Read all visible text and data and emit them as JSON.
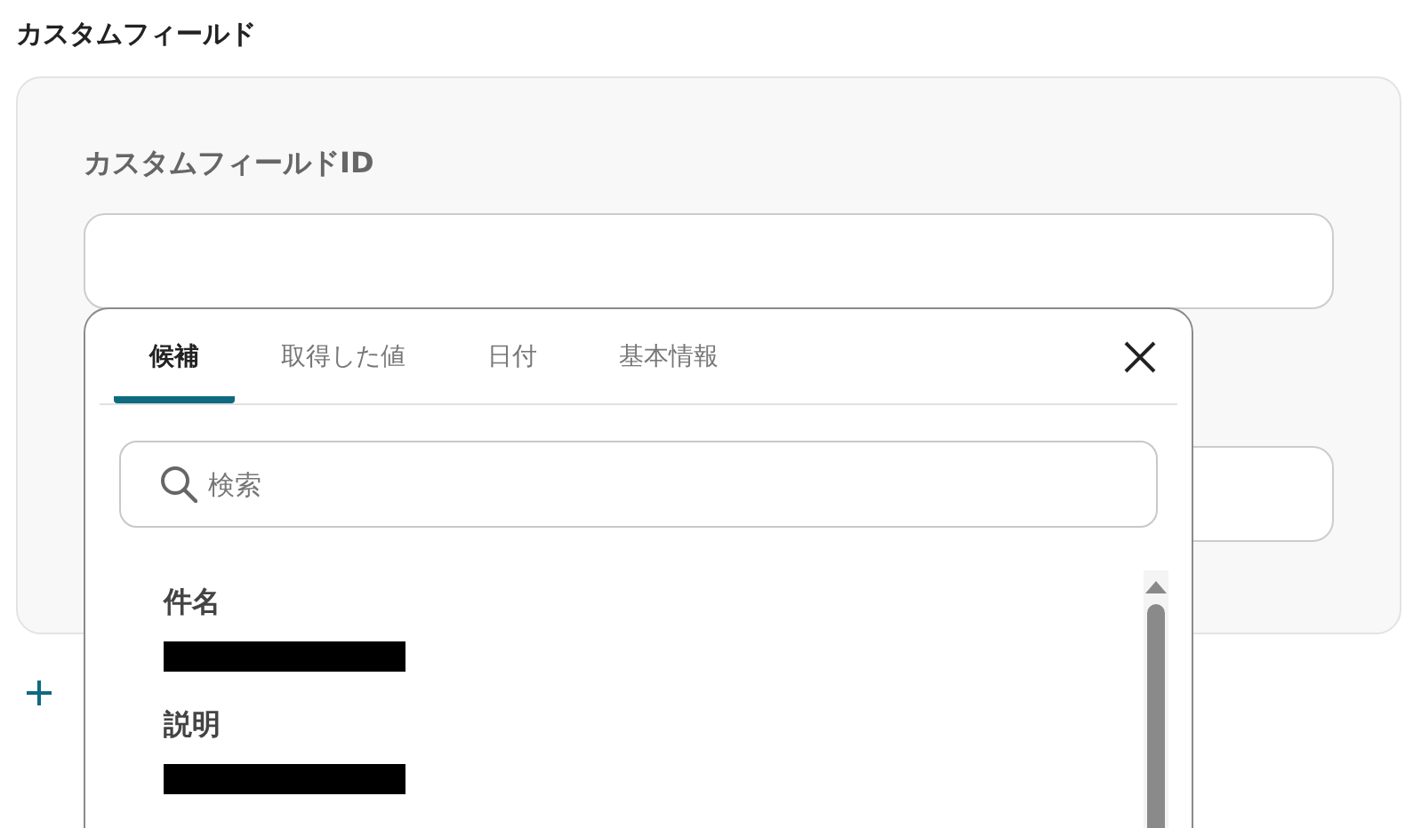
{
  "section_title": "カスタムフィールド",
  "fields": [
    {
      "label": "カスタムフィールドID"
    }
  ],
  "popup": {
    "tabs": [
      {
        "label": "候補",
        "selected": true
      },
      {
        "label": "取得した値",
        "selected": false
      },
      {
        "label": "日付",
        "selected": false
      },
      {
        "label": "基本情報",
        "selected": false
      }
    ],
    "search": {
      "placeholder": "検索"
    },
    "items": [
      {
        "name": "件名",
        "value_redacted": true
      },
      {
        "name": "説明",
        "value_redacted": true
      }
    ]
  }
}
